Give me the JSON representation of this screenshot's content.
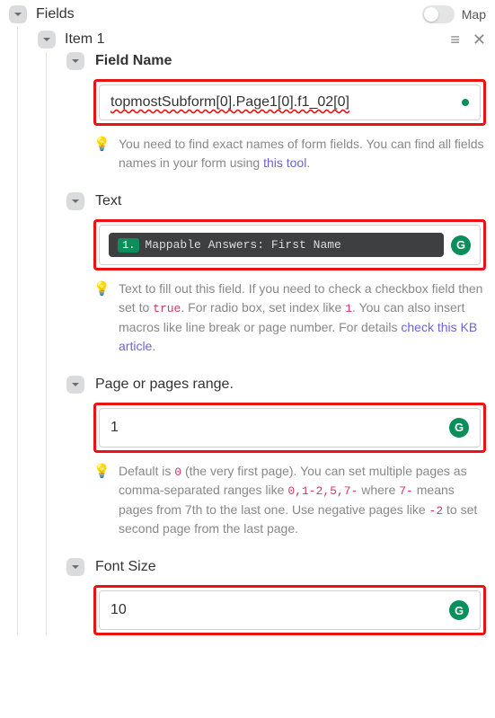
{
  "top": {
    "fields_label": "Fields",
    "map_label": "Map"
  },
  "item": {
    "title": "Item 1"
  },
  "field_name": {
    "label": "Field Name",
    "value": "topmostSubform[0].Page1[0].f1_02[0]",
    "hint_pre": "You need to find exact names of form fields. You can find all fields names in your form using ",
    "hint_link": "this tool",
    "hint_post": "."
  },
  "text_field": {
    "label": "Text",
    "pill_num": "1.",
    "pill_text": "Mappable Answers: First Name",
    "hint_1": "Text to fill out this field. If you need to check a checkbox field then set to ",
    "code_true": "true",
    "hint_2": ". For radio box, set index like ",
    "code_1": "1",
    "hint_3": ". You can also insert macros like line break or page number. For details ",
    "hint_link": "check this KB article",
    "hint_4": "."
  },
  "page_range": {
    "label": "Page or pages range.",
    "value": "1",
    "hint_1": "Default is ",
    "code_0": "0",
    "hint_2": " (the very first page). You can set multiple pages as comma-separated ranges like ",
    "code_range": "0,1-2,5,7-",
    "hint_3": " where ",
    "code_7": "7-",
    "hint_4": " means pages from 7th to the last one. Use negative pages like ",
    "code_neg2": "-2",
    "hint_5": " to set second page from the last page."
  },
  "font_size": {
    "label": "Font Size",
    "value": "10"
  }
}
